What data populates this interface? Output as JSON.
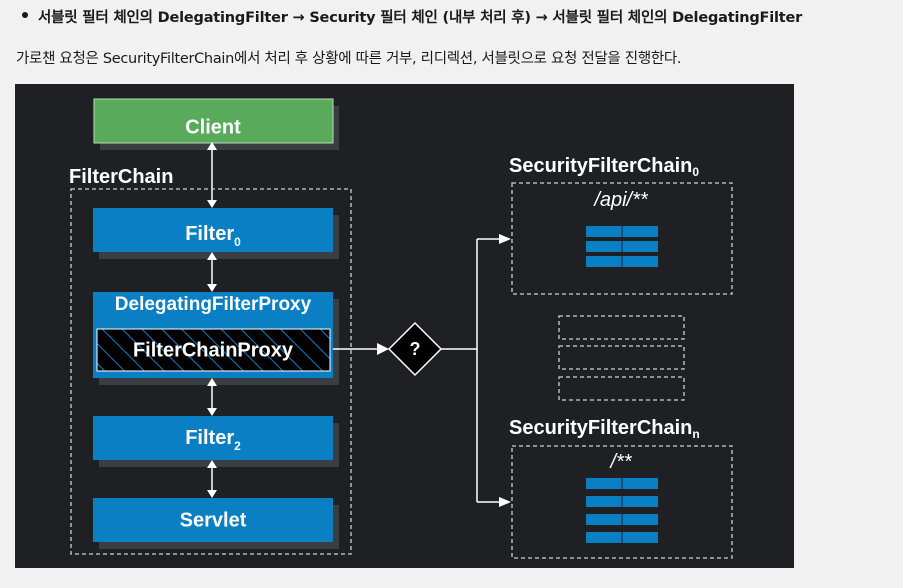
{
  "bullet": {
    "text": "서블릿 필터 체인의 DelegatingFilter → Security 필터 체인 (내부 처리 후) → 서블릿 필터 체인의 DelegatingFilter"
  },
  "paragraph": {
    "text": "가로챈 요청은 SecurityFilterChain에서 처리 후 상황에 따른 거부, 리디렉션, 서블릿으로 요청 전달을 진행한다."
  },
  "diagram": {
    "client": "Client",
    "filterchain_label": "FilterChain",
    "filter0_name": "Filter",
    "filter0_sub": "0",
    "delegating_proxy": "DelegatingFilterProxy",
    "filterchain_proxy": "FilterChainProxy",
    "filter2_name": "Filter",
    "filter2_sub": "2",
    "servlet": "Servlet",
    "decision": "?",
    "sfc0_name": "SecurityFilterChain",
    "sfc0_sub": "0",
    "sfc0_pattern": "/api/**",
    "sfcn_name": "SecurityFilterChain",
    "sfcn_sub": "n",
    "sfcn_pattern": "/**",
    "colors": {
      "client_green": "#5aaa5c",
      "filter_blue": "#0b7fc4",
      "background": "#1e2024"
    }
  }
}
